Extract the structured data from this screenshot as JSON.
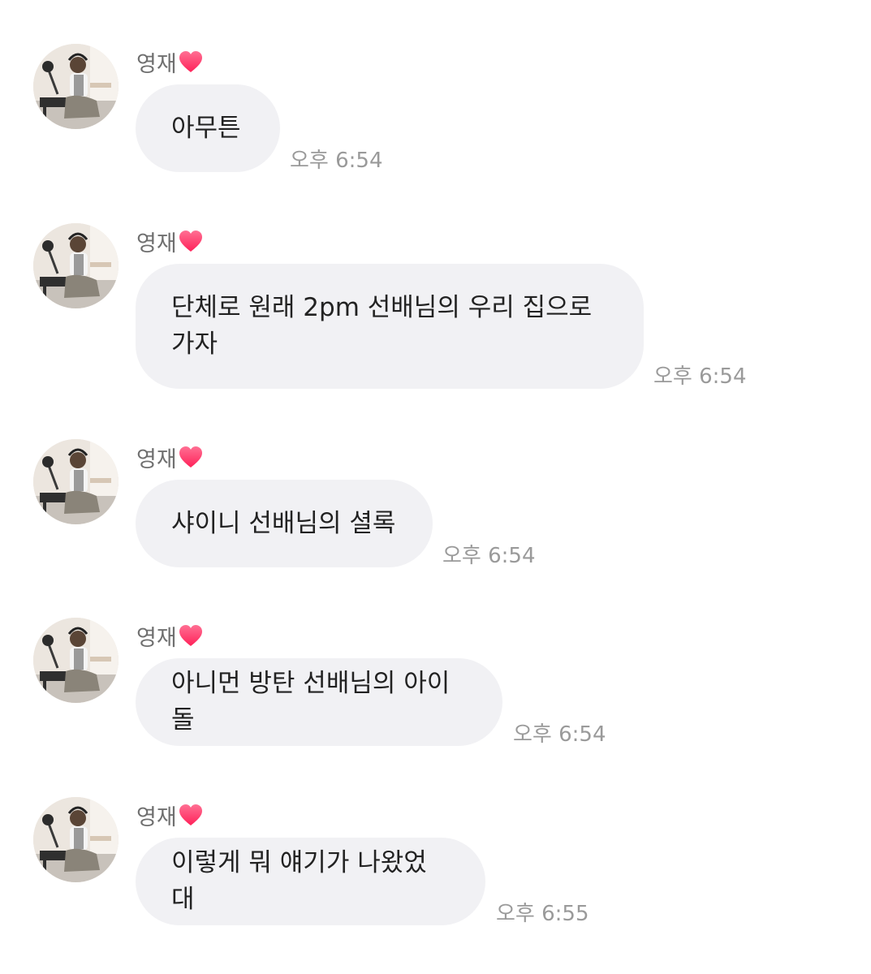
{
  "sender": {
    "name": "영재",
    "icon": "heart-icon"
  },
  "messages": [
    {
      "text": "아무튼",
      "time": "오후 6:54"
    },
    {
      "text": "단체로 원래 2pm 선배님의 우리 집으로\n가자",
      "time": "오후 6:54"
    },
    {
      "text": "샤이니 선배님의 셜록",
      "time": "오후 6:54"
    },
    {
      "text": "아니먼 방탄 선배님의 아이돌",
      "time": "오후 6:54"
    },
    {
      "text": "이렇게 뭐 얘기가 나왔었대",
      "time": "오후 6:55"
    }
  ],
  "colors": {
    "bubble": "#f1f1f4",
    "heart": "#ff3d6e",
    "name": "#6f6f6f",
    "time": "#9a9a9a",
    "text": "#222222"
  }
}
